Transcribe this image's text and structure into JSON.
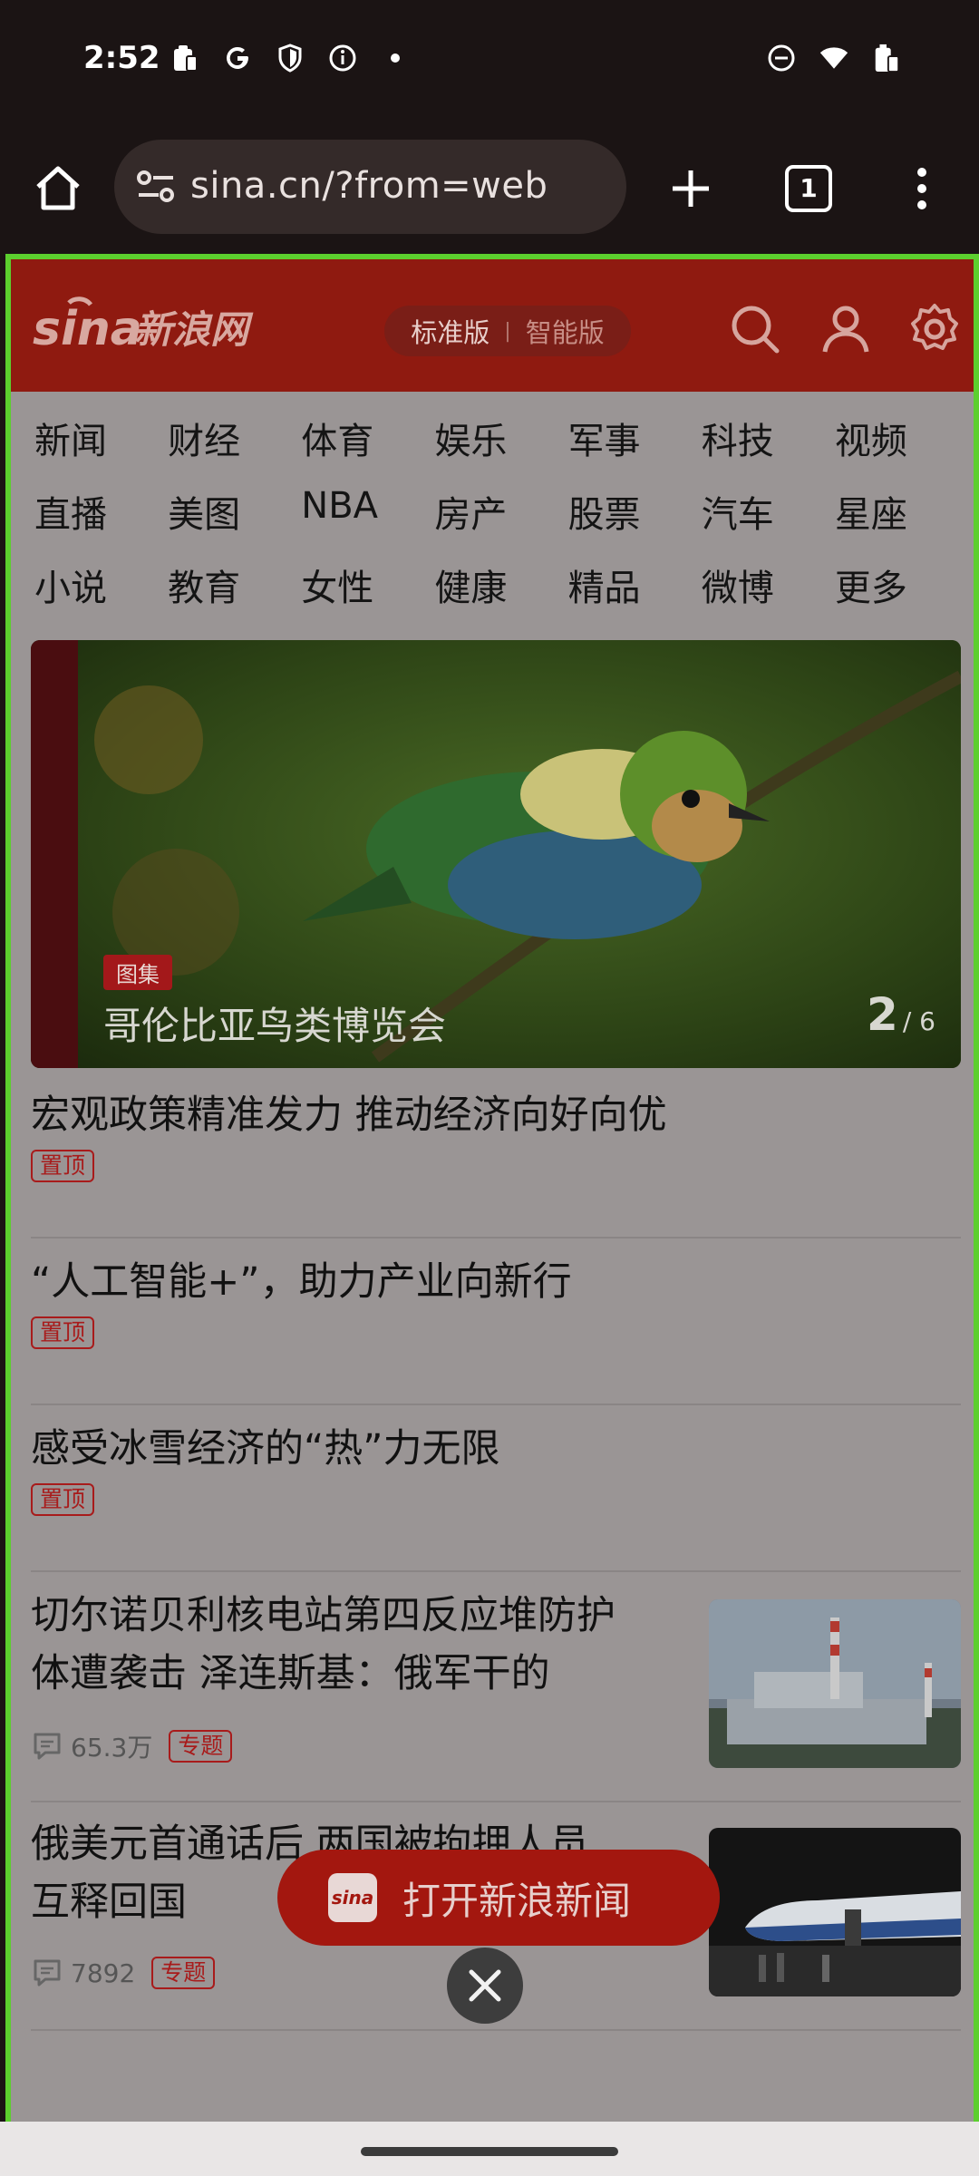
{
  "status_bar": {
    "time": "2:52",
    "left_icons": [
      "clipboard-icon",
      "google-icon",
      "shield-icon",
      "info-icon",
      "dot-icon"
    ],
    "right_icons": [
      "dnd-icon",
      "wifi-icon",
      "battery-icon"
    ]
  },
  "browser": {
    "url": "sina.cn/?from=web",
    "tab_count": "1"
  },
  "sina": {
    "logo_text": "sina 新浪网",
    "version_standard": "标准版",
    "version_ai": "智能版",
    "nav_rows": [
      [
        "新闻",
        "财经",
        "体育",
        "娱乐",
        "军事",
        "科技",
        "视频"
      ],
      [
        "直播",
        "美图",
        "NBA",
        "房产",
        "股票",
        "汽车",
        "星座"
      ],
      [
        "小说",
        "教育",
        "女性",
        "健康",
        "精品",
        "微博",
        "更多"
      ]
    ],
    "slideshow": {
      "badge": "图集",
      "title": "哥伦比亚鸟类博览会",
      "current": "2",
      "total": "/ 6"
    },
    "news": [
      {
        "title": "宏观政策精准发力 推动经济向好向优",
        "tag": "置顶"
      },
      {
        "title": "“人工智能+”，助力产业向新行",
        "tag": "置顶"
      },
      {
        "title": "感受冰雪经济的“热”力无限",
        "tag": "置顶"
      },
      {
        "title_line1": "切尔诺贝利核电站第四反应堆防护",
        "title_line2": "体遭袭击 泽连斯基：俄军干的",
        "comments": "65.3万",
        "tag": "专题"
      },
      {
        "title_line1": "俄美元首通话后 两国被拘押人员",
        "title_line2": "互释回国",
        "comments": "7892",
        "tag": "专题"
      }
    ],
    "cta_label": "打开新浪新闻",
    "cta_logo": "sina"
  },
  "colors": {
    "sina_red": "#8f1a10",
    "selection_border": "#5ccf2e",
    "tag_red": "#a81b1b"
  }
}
